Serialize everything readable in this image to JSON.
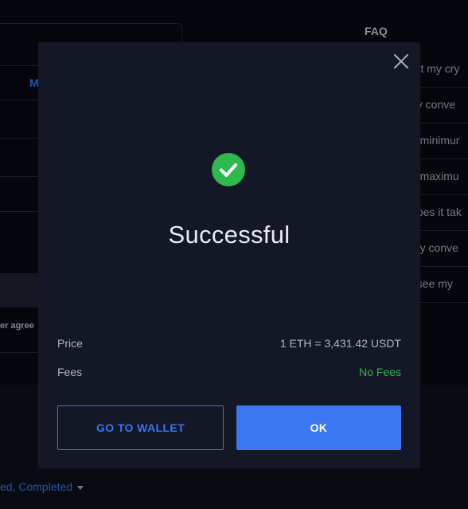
{
  "background": {
    "tab_label": "M",
    "agreement_text": "er agree",
    "faq": {
      "title": "FAQ",
      "items": [
        "ert my cry",
        "ny conve",
        "e minimur",
        "e maximu",
        "does it tak",
        "my conve",
        "I see my"
      ]
    },
    "filter_text": "ed, Completed"
  },
  "modal": {
    "title": "Successful",
    "details": [
      {
        "label": "Price",
        "value": "1 ETH = 3,431.42 USDT"
      },
      {
        "label": "Fees",
        "value": "No Fees"
      }
    ],
    "buttons": {
      "wallet_label": "GO TO WALLET",
      "ok_label": "OK"
    }
  },
  "colors": {
    "accent": "#3a78f2",
    "success": "#2eb84e",
    "fees_free": "#34b34f"
  },
  "icons": {
    "close": "close-icon",
    "success": "checkmark-icon",
    "filter_caret": "caret-down-icon"
  }
}
